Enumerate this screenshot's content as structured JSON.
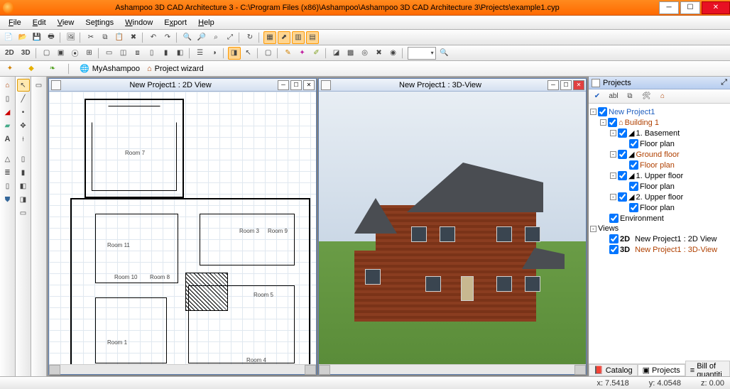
{
  "titlebar": {
    "title": "Ashampoo 3D CAD Architecture 3 - C:\\Program Files (x86)\\Ashampoo\\Ashampoo 3D CAD Architecture 3\\Projects\\example1.cyp"
  },
  "menus": [
    "File",
    "Edit",
    "View",
    "Settings",
    "Window",
    "Export",
    "Help"
  ],
  "launcher": {
    "ashampoo": "MyAshampoo",
    "wizard": "Project wizard"
  },
  "doc2d": {
    "title": "New Project1 : 2D View",
    "rooms": [
      "Room 1",
      "Room 3",
      "Room 4",
      "Room 5",
      "Room 7",
      "Room 8",
      "Room 9",
      "Room 10",
      "Room 11"
    ]
  },
  "doc3d": {
    "title": "New Project1 : 3D-View"
  },
  "projects": {
    "panel_title": "Projects",
    "root": "New Project1",
    "building": "Building 1",
    "floors": [
      {
        "label": "1. Basement",
        "plan": "Floor plan"
      },
      {
        "label": "Ground floor",
        "plan": "Floor plan"
      },
      {
        "label": "1. Upper floor",
        "plan": "Floor plan"
      },
      {
        "label": "2. Upper floor",
        "plan": "Floor plan"
      }
    ],
    "environment": "Environment",
    "views_label": "Views",
    "views": [
      {
        "tag": "2D",
        "label": "New Project1 : 2D View"
      },
      {
        "tag": "3D",
        "label": "New Project1 : 3D-View"
      }
    ],
    "tabs": [
      "Catalog",
      "Projects",
      "Bill of quantiti"
    ]
  },
  "status": {
    "x": "x: 7.5418",
    "y": "y: 4.0548",
    "z": "z: 0.00"
  }
}
